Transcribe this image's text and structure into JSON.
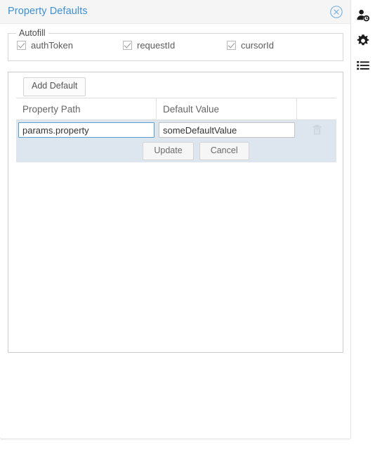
{
  "window": {
    "title": "Property Defaults",
    "close_icon": "close-circle-icon"
  },
  "autofill": {
    "legend": "Autofill",
    "checkboxes": [
      {
        "label": "authToken",
        "checked": true
      },
      {
        "label": "requestId",
        "checked": true
      },
      {
        "label": "cursorId",
        "checked": true
      }
    ]
  },
  "defaults_table": {
    "add_button_label": "Add Default",
    "columns": [
      "Property Path",
      "Default Value",
      ""
    ],
    "rows": [
      {
        "property_path": "params.property",
        "default_value": "someDefaultValue",
        "property_path_placeholder": "",
        "default_value_placeholder": "",
        "delete_icon": "trash-icon",
        "selected": true
      }
    ],
    "row_actions": {
      "update_label": "Update",
      "cancel_label": "Cancel"
    }
  },
  "right_rail": {
    "items": [
      {
        "icon": "user-clock-icon"
      },
      {
        "icon": "gear-icon"
      },
      {
        "icon": "list-icon"
      }
    ]
  },
  "colors": {
    "title_blue": "#3d8fd8",
    "row_selected": "#dde6ee",
    "input_focus_border": "#5a9fd4",
    "header_bg": "#f5f5f5"
  }
}
